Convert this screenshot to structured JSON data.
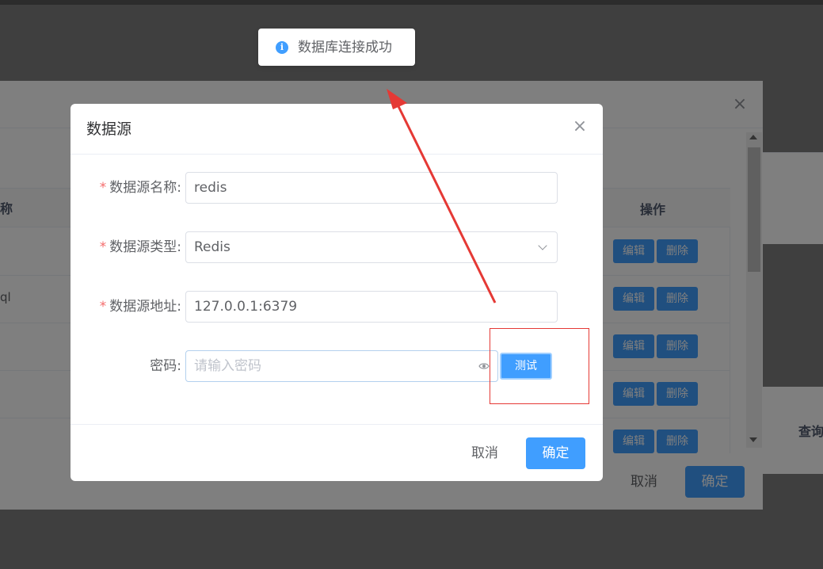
{
  "toast": {
    "message": "数据库连接成功",
    "icon": "info-icon"
  },
  "parent_dialog": {
    "close_symbol": "×",
    "table": {
      "header_col1": "称",
      "header_op": "操作",
      "rows": [
        {
          "text": "",
          "edit_label": "编辑",
          "delete_label": "删除"
        },
        {
          "text": "ql",
          "edit_label": "编辑",
          "delete_label": "删除"
        },
        {
          "text": "",
          "edit_label": "编辑",
          "delete_label": "删除"
        },
        {
          "text": "",
          "edit_label": "编辑",
          "delete_label": "删除"
        },
        {
          "text": "",
          "edit_label": "编辑",
          "delete_label": "删除"
        }
      ]
    },
    "side_label": "查询",
    "footer": {
      "cancel_label": "取消",
      "ok_label": "确定"
    }
  },
  "modal": {
    "title": "数据源",
    "close_symbol": "×",
    "required_mark": "*",
    "fields": {
      "name": {
        "label": "数据源名称:",
        "value": "redis"
      },
      "type": {
        "label": "数据源类型:",
        "value": "Redis"
      },
      "address": {
        "label": "数据源地址:",
        "value": "127.0.0.1:6379"
      },
      "password": {
        "label": "密码:",
        "value": "",
        "placeholder": "请输入密码"
      }
    },
    "test_label": "测试",
    "footer": {
      "cancel_label": "取消",
      "ok_label": "确定"
    }
  },
  "colors": {
    "primary": "#409eff",
    "annotation_red": "#e53935",
    "required": "#f56c6c"
  }
}
